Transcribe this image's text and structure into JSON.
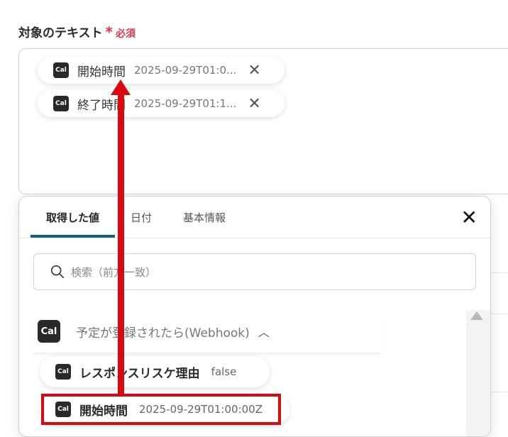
{
  "field": {
    "label": "対象のテキスト",
    "required_mark": "*",
    "required_text": "必須"
  },
  "chips": [
    {
      "icon": "Cal",
      "name": "開始時間",
      "value": "2025-09-29T01:0..."
    },
    {
      "icon": "Cal",
      "name": "終了時間",
      "value": "2025-09-29T01:1..."
    }
  ],
  "tabs": [
    {
      "label": "取得した値",
      "active": true
    },
    {
      "label": "日付",
      "active": false
    },
    {
      "label": "基本情報",
      "active": false
    }
  ],
  "search": {
    "placeholder": "検索（前方一致）"
  },
  "group": {
    "icon": "Cal",
    "title": "予定が登録されたら(Webhook)"
  },
  "items": [
    {
      "icon": "Cal",
      "name": "レスポンスリスケ理由",
      "value": "false"
    },
    {
      "icon": "Cal",
      "name": "開始時間",
      "value": "2025-09-29T01:00:00Z"
    }
  ],
  "colors": {
    "required": "#e0374f",
    "tab_active_underline": "#175f7a",
    "annotation_red": "#d80a10",
    "cal_icon_bg": "#292929"
  }
}
